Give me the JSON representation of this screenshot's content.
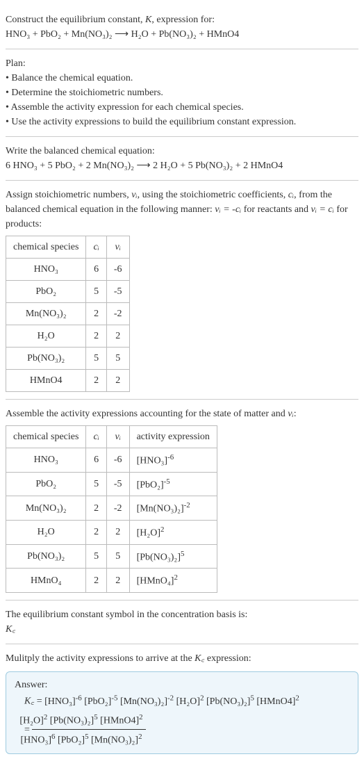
{
  "intro": {
    "line1": "Construct the equilibrium constant, ",
    "K": "K",
    "line1b": ", expression for:",
    "eq": "HNO₃ + PbO₂ + Mn(NO₃)₂  ⟶  H₂O + Pb(NO₃)₂ + HMnO4"
  },
  "plan": {
    "heading": "Plan:",
    "b1": "• Balance the chemical equation.",
    "b2": "• Determine the stoichiometric numbers.",
    "b3": "• Assemble the activity expression for each chemical species.",
    "b4": "• Use the activity expressions to build the equilibrium constant expression."
  },
  "balanced": {
    "heading": "Write the balanced chemical equation:",
    "eq": "6 HNO₃ + 5 PbO₂ + 2 Mn(NO₃)₂  ⟶  2 H₂O + 5 Pb(NO₃)₂ + 2 HMnO4"
  },
  "assign": {
    "text_a": "Assign stoichiometric numbers, ",
    "nu_i": "νᵢ",
    "text_b": ", using the stoichiometric coefficients, ",
    "c_i": "cᵢ",
    "text_c": ", from the balanced chemical equation in the following manner: ",
    "rel1": "νᵢ = -cᵢ",
    "text_d": " for reactants and ",
    "rel2": "νᵢ = cᵢ",
    "text_e": " for products:",
    "table": {
      "h1": "chemical species",
      "h2": "cᵢ",
      "h3": "νᵢ",
      "rows": [
        {
          "sp": "HNO₃",
          "c": "6",
          "nu": "-6"
        },
        {
          "sp": "PbO₂",
          "c": "5",
          "nu": "-5"
        },
        {
          "sp": "Mn(NO₃)₂",
          "c": "2",
          "nu": "-2"
        },
        {
          "sp": "H₂O",
          "c": "2",
          "nu": "2"
        },
        {
          "sp": "Pb(NO₃)₂",
          "c": "5",
          "nu": "5"
        },
        {
          "sp": "HMnO4",
          "c": "2",
          "nu": "2"
        }
      ]
    }
  },
  "assemble": {
    "heading_a": "Assemble the activity expressions accounting for the state of matter and ",
    "nu_i": "νᵢ",
    "heading_b": ":",
    "table": {
      "h1": "chemical species",
      "h2": "cᵢ",
      "h3": "νᵢ",
      "h4": "activity expression",
      "rows": [
        {
          "sp": "HNO₃",
          "c": "6",
          "nu": "-6",
          "ae_base": "[HNO₃]",
          "ae_exp": "-6"
        },
        {
          "sp": "PbO₂",
          "c": "5",
          "nu": "-5",
          "ae_base": "[PbO₂]",
          "ae_exp": "-5"
        },
        {
          "sp": "Mn(NO₃)₂",
          "c": "2",
          "nu": "-2",
          "ae_base": "[Mn(NO₃)₂]",
          "ae_exp": "-2"
        },
        {
          "sp": "H₂O",
          "c": "2",
          "nu": "2",
          "ae_base": "[H₂O]",
          "ae_exp": "2"
        },
        {
          "sp": "Pb(NO₃)₂",
          "c": "5",
          "nu": "5",
          "ae_base": "[Pb(NO₃)₂]",
          "ae_exp": "5"
        },
        {
          "sp": "HMnO₄",
          "c": "2",
          "nu": "2",
          "ae_base": "[HMnO₄]",
          "ae_exp": "2"
        }
      ]
    }
  },
  "symbol": {
    "line": "The equilibrium constant symbol in the concentration basis is:",
    "Kc": "K꜀"
  },
  "multiply": {
    "line_a": "Mulitply the activity expressions to arrive at the ",
    "Kc": "K꜀",
    "line_b": " expression:"
  },
  "answer": {
    "label": "Answer:",
    "Kc": "K꜀",
    "eq_flat_parts": [
      {
        "b": "[HNO₃]",
        "e": "-6"
      },
      {
        "b": "[PbO₂]",
        "e": "-5"
      },
      {
        "b": "[Mn(NO₃)₂]",
        "e": "-2"
      },
      {
        "b": "[H₂O]",
        "e": "2"
      },
      {
        "b": "[Pb(NO₃)₂]",
        "e": "5"
      },
      {
        "b": "[HMnO4]",
        "e": "2"
      }
    ],
    "num_parts": [
      {
        "b": "[H₂O]",
        "e": "2"
      },
      {
        "b": "[Pb(NO₃)₂]",
        "e": "5"
      },
      {
        "b": "[HMnO4]",
        "e": "2"
      }
    ],
    "den_parts": [
      {
        "b": "[HNO₃]",
        "e": "6"
      },
      {
        "b": "[PbO₂]",
        "e": "5"
      },
      {
        "b": "[Mn(NO₃)₂]",
        "e": "2"
      }
    ]
  }
}
